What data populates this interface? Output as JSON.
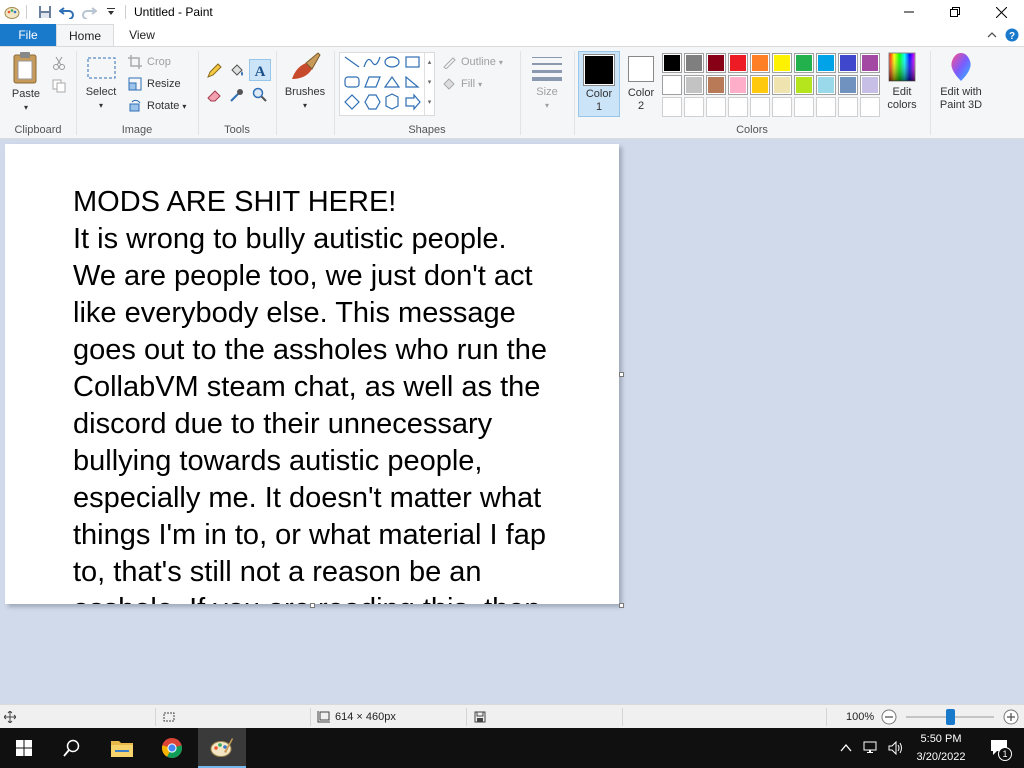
{
  "window": {
    "title": "Untitled - Paint"
  },
  "tabs": {
    "file": "File",
    "home": "Home",
    "view": "View"
  },
  "clipboard": {
    "paste": "Paste",
    "group": "Clipboard"
  },
  "image": {
    "select": "Select",
    "crop": "Crop",
    "resize": "Resize",
    "rotate": "Rotate",
    "group": "Image"
  },
  "tools": {
    "group": "Tools"
  },
  "brushes": {
    "label": "Brushes"
  },
  "shapes": {
    "outline": "Outline",
    "fill": "Fill",
    "group": "Shapes"
  },
  "size": {
    "label": "Size"
  },
  "colors": {
    "color1_line1": "Color",
    "color1_line2": "1",
    "color2_line1": "Color",
    "color2_line2": "2",
    "edit_line1": "Edit",
    "edit_line2": "colors",
    "group": "Colors",
    "paint3d_line1": "Edit with",
    "paint3d_line2": "Paint 3D",
    "color1": "#000000",
    "color2": "#ffffff",
    "palette_row1": [
      "#000000",
      "#7f7f7f",
      "#880015",
      "#ed1c24",
      "#ff7f27",
      "#fff200",
      "#22b14c",
      "#00a2e8",
      "#3f48cc",
      "#a349a4"
    ],
    "palette_row2": [
      "#ffffff",
      "#c3c3c3",
      "#b97a57",
      "#ffaec9",
      "#ffc90e",
      "#efe4b0",
      "#b5e61d",
      "#99d9ea",
      "#7092be",
      "#c8bfe7"
    ]
  },
  "canvas": {
    "text": "MODS ARE SHIT HERE!\nIt is wrong to bully autistic people.\nWe are people too, we just don't act\nlike everybody else. This message\ngoes out to the assholes who run the\nCollabVM steam chat, as well as the\ndiscord due to their unnecessary\nbullying towards autistic people,\nespecially me. It doesn't matter what\nthings I'm in to, or what material I fap\nto, that's still not a reason be an\nasshole. If you are reading this, then"
  },
  "status": {
    "dimensions": "614 × 460px",
    "zoom": "100%",
    "zoom_level": 0.5
  },
  "taskbar": {
    "time": "5:50 PM",
    "date": "3/20/2022",
    "notifications": "1"
  }
}
